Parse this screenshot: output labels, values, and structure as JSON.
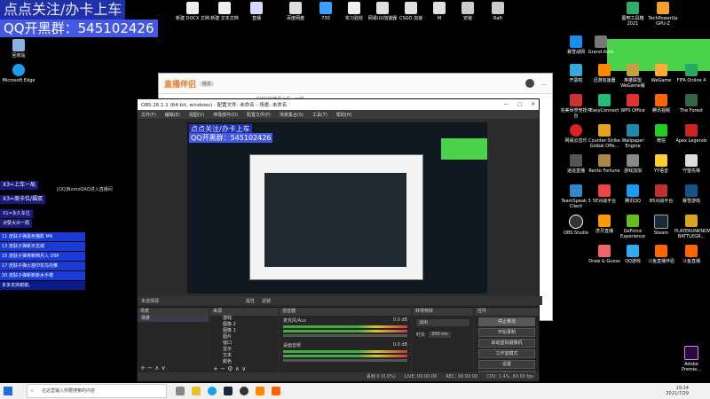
{
  "overlay": {
    "line1": "点点关注/办卡上车",
    "line2_prefix": "QQ开黑群：",
    "line2_number": "545102426"
  },
  "desktop_left": [
    {
      "label": "回收站"
    },
    {
      "label": "Microsoft Edge"
    }
  ],
  "desktop_top": [
    {
      "label": "新建 DOCX 文档"
    },
    {
      "label": "新建 文本文档"
    },
    {
      "label": "直播"
    },
    {
      "label": "百度网盘"
    },
    {
      "label": "730"
    },
    {
      "label": "实习验收"
    },
    {
      "label": "网易UU加速器"
    },
    {
      "label": "CSGO 加速"
    },
    {
      "label": "M"
    },
    {
      "label": "安装"
    },
    {
      "label": "Raft"
    },
    {
      "label": "图吧工具箱 2021"
    },
    {
      "label": "TechPowerUp GPU-Z"
    }
  ],
  "desktop_right": [
    {
      "label": "暴雪战网"
    },
    {
      "label": "Grand Auto"
    },
    {
      "label": "开黑啦"
    },
    {
      "label": "迅游加速器"
    },
    {
      "label": "英雄联盟 WeGame版"
    },
    {
      "label": "ONLINE"
    },
    {
      "label": "WeGame"
    },
    {
      "label": "FIFA Online 4"
    },
    {
      "label": "完美世界竞技平台"
    },
    {
      "label": "EasyConnect"
    },
    {
      "label": "WPS Office"
    },
    {
      "label": "腾讯视频"
    },
    {
      "label": "The Forest"
    },
    {
      "label": "网易云音乐"
    },
    {
      "label": "Counter-Strike Global Offe..."
    },
    {
      "label": "Wallpaper Engine"
    },
    {
      "label": "微信"
    },
    {
      "label": "Apex Legends"
    },
    {
      "label": "逍遥直播"
    },
    {
      "label": "Rento Fortune"
    },
    {
      "label": "游戏加加"
    },
    {
      "label": "YY语音"
    },
    {
      "label": "守望先锋"
    },
    {
      "label": "TeamSpeak 3 Client"
    },
    {
      "label": "5E对战平台"
    },
    {
      "label": "腾讯QQ"
    },
    {
      "label": "B5对战平台"
    },
    {
      "label": "暴雪游戏"
    },
    {
      "label": "OBS Studio"
    },
    {
      "label": "虎牙直播"
    },
    {
      "label": "GeForce Experience"
    },
    {
      "label": "Steam"
    },
    {
      "label": "PLAYERUNKNOWN'S BATTLEGR..."
    },
    {
      "label": "Draw & Guess"
    },
    {
      "label": "QQ游戏"
    },
    {
      "label": "斗鱼直播伴侣"
    },
    {
      "label": "斗鱼直播"
    },
    {
      "label": "Adobe Premie..."
    }
  ],
  "browser": {
    "brand": "直播伴侣",
    "badge": "版本",
    "tab_text": "[CSGO]开黑上车，一线",
    "ellipsis": "..."
  },
  "obs": {
    "title": "OBS 26.1.1 (64-bit, windows) - 配置文件: 未命名 - 场景: 未命名",
    "menu": [
      "文件(F)",
      "编辑(E)",
      "视图(V)",
      "停靠部件(D)",
      "配置文件(P)",
      "场景集合(S)",
      "工具(T)",
      "帮助(H)"
    ],
    "preview_overlay1": "点点关注/办卡上车",
    "preview_overlay2": "QQ开黑群：545102426",
    "no_source": "未选择源",
    "properties": "属性",
    "filters": "滤镜",
    "panels": {
      "scenes": "场景",
      "sources": "来源",
      "mixer": "混音器",
      "transitions": "转场特效",
      "controls": "控件"
    },
    "scene_items": [
      "场景"
    ],
    "source_items": [
      "游戏",
      "图像 2",
      "图像 1",
      "图片",
      "窗口",
      "显示",
      "文本",
      "颜色"
    ],
    "mixer_tracks": [
      {
        "name": "麦克风/Aux",
        "db": "0.0 dB"
      },
      {
        "name": "桌面音频",
        "db": "0.0 dB"
      }
    ],
    "transition": {
      "type": "淡出",
      "duration_label": "时长",
      "duration_value": "300 ms"
    },
    "controls": [
      "停止推流",
      "开始录制",
      "启动虚拟摄像机",
      "工作室模式",
      "设置",
      "退出"
    ],
    "status": {
      "drop": "丢帧 0 (0.0%)",
      "live": "LIVE: 00:00:00",
      "rec": "REC: 00:00:00",
      "cpu": "CPU: 1.4%, 60.00 fps"
    }
  },
  "left_overlay": {
    "tag1": "X3=上车一局",
    "stream_id": "[QQ]NomoQAQ进入直播间",
    "tag2": "X3=周卡位/福双",
    "tag3": "X1=永久车位",
    "tag4": "点赞大众一局",
    "list": [
      "11 皮肤子弹黑色猫影 M4",
      "13 皮肤子弹新天龙城",
      "15 皮肤子弹将新倒月入 USP",
      "17 皮肤子弹火苗印花鸟勿推",
      "20 皮肤子弹新新新水手楼",
      "多多支持谢谢。"
    ]
  },
  "taskbar": {
    "search_placeholder": "在这里输入你要搜索的内容",
    "time": "19:24",
    "date": "2021/7/29"
  }
}
